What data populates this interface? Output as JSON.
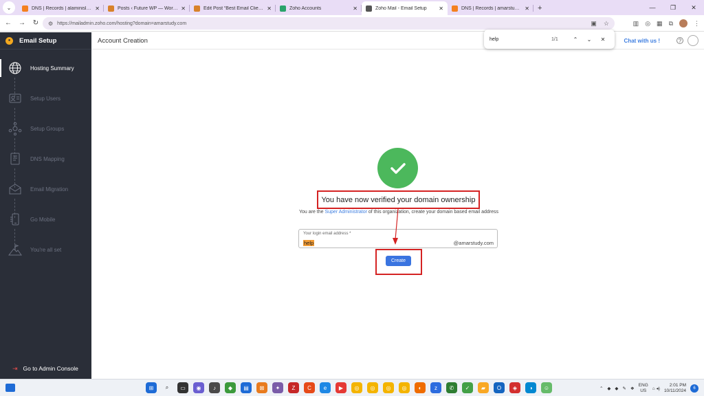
{
  "browser": {
    "tabs": [
      {
        "title": "DNS | Records | alaminislam.me",
        "color": "#f48120",
        "active": false
      },
      {
        "title": "Posts ‹ Future WP — WordPress",
        "color": "#d8822a",
        "active": false
      },
      {
        "title": "Edit Post “Best Email Client For",
        "color": "#d8822a",
        "active": false
      },
      {
        "title": "Zoho Accounts",
        "color": "#2aa36b",
        "active": false
      },
      {
        "title": "Zoho Mail - Email Setup",
        "color": "#555555",
        "active": true
      },
      {
        "title": "DNS | Records | amarstudy.com",
        "color": "#f48120",
        "active": false
      }
    ],
    "url": "https://mailadmin.zoho.com/hosting?domain=amarstudy.com"
  },
  "findbar": {
    "query": "help",
    "count": "1/1"
  },
  "sidebar": {
    "title": "Email Setup",
    "steps": [
      {
        "label": "Hosting Summary",
        "icon": "globe-icon",
        "active": true
      },
      {
        "label": "Setup Users",
        "icon": "user-card-icon",
        "active": false
      },
      {
        "label": "Setup Groups",
        "icon": "group-icon",
        "active": false
      },
      {
        "label": "DNS Mapping",
        "icon": "document-icon",
        "active": false
      },
      {
        "label": "Email Migration",
        "icon": "envelope-icon",
        "active": false
      },
      {
        "label": "Go Mobile",
        "icon": "mobile-icon",
        "active": false
      },
      {
        "label": "You're all set",
        "icon": "flag-mountain-icon",
        "active": false
      }
    ],
    "footer": "Go to Admin Console"
  },
  "header": {
    "title": "Account Creation",
    "chat": "Chat with us !"
  },
  "content": {
    "headline": "You have now verified your domain ownership",
    "sub_before": "You are the ",
    "sub_role": "Super Administrator",
    "sub_after": " of this organization, create your domain based email address",
    "field_label": "Your login email address *",
    "field_value": "help",
    "field_domain": "@amarstudy.com",
    "create_label": "Create"
  },
  "taskbar": {
    "lang_top": "ENG",
    "lang_bottom": "US",
    "time": "2:01 PM",
    "date": "10/11/2024",
    "badge": "6"
  },
  "colors": {
    "accent": "#3a74e0",
    "success": "#4cb85c",
    "annotation": "#d42222",
    "sidebar": "#2a2e38"
  }
}
